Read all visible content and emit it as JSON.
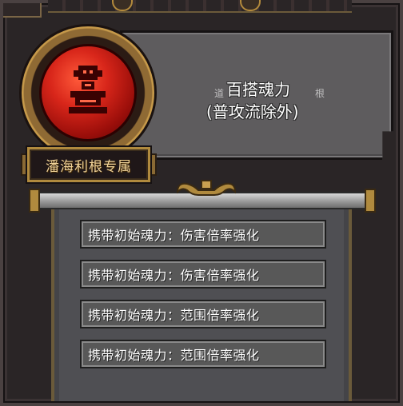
{
  "character": {
    "name_plate": "潘海利根专属"
  },
  "description": {
    "ghost_left": "道",
    "ghost_right": "根",
    "title": "百搭魂力",
    "subtitle": "(普攻流除外)"
  },
  "stats": [
    {
      "label": "携带初始魂力：伤害倍率强化"
    },
    {
      "label": "携带初始魂力：伤害倍率强化"
    },
    {
      "label": "携带初始魂力：范围倍率强化"
    },
    {
      "label": "携带初始魂力：范围倍率强化"
    }
  ],
  "colors": {
    "medallion_red": "#d8261a",
    "gold_trim": "#b08a3e",
    "plate_text": "#f1d49a",
    "panel_gray": "#5e5c5e"
  },
  "icons": {
    "medallion": "red-totem-emblem-icon",
    "scroll_ornament": "gold-scroll-ornament-icon"
  }
}
